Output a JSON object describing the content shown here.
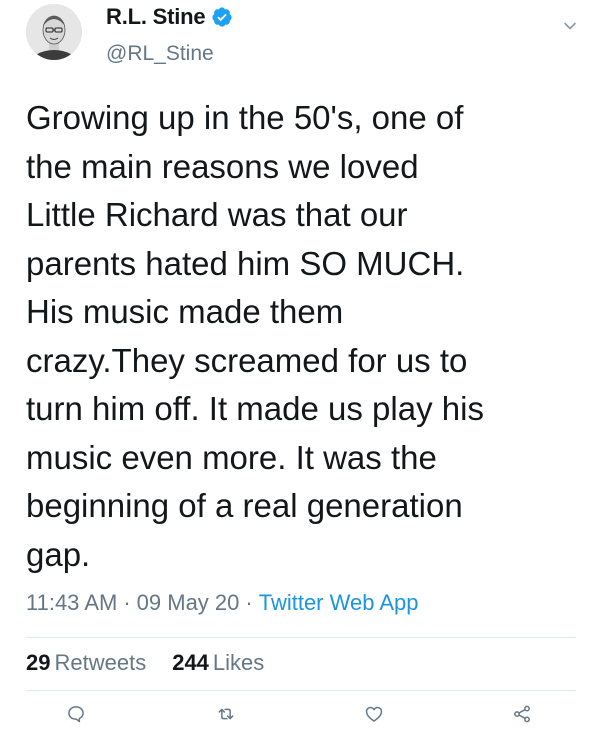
{
  "author": {
    "display_name": "R.L. Stine",
    "handle": "@RL_Stine",
    "verified": true
  },
  "tweet": {
    "text": "Growing up in the 50's, one of\nthe main reasons we loved\nLittle Richard was that our\nparents hated him SO MUCH.\nHis music made them\ncrazy.They screamed for us to\nturn him off. It made us play his\nmusic even more. It was the\nbeginning of a real generation\ngap.",
    "time": "11:43 AM",
    "date": "09 May 20",
    "source": "Twitter Web App",
    "separator": "·"
  },
  "stats": {
    "retweets_count": "29",
    "retweets_label": "Retweets",
    "likes_count": "244",
    "likes_label": "Likes"
  },
  "icons": {
    "verified": "verified-badge-icon",
    "caret": "chevron-down-icon",
    "reply": "reply-icon",
    "retweet": "retweet-icon",
    "like": "heart-icon",
    "share": "share-icon"
  },
  "colors": {
    "primary_text": "#14171a",
    "secondary_text": "#657786",
    "link": "#1b95e0",
    "verified": "#1da1f2",
    "divider": "#e1e8ed"
  }
}
